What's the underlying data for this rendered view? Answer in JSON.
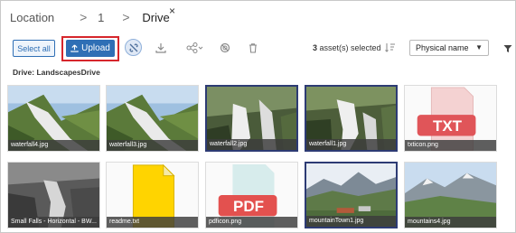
{
  "breadcrumb": {
    "location": "Location",
    "level1": "1",
    "current": "Drive",
    "separator": ">",
    "close_glyph": "×"
  },
  "toolbar": {
    "select_all_label": "Select all",
    "upload_label": "Upload",
    "selection_count": "3",
    "selection_suffix": " asset(s) selected",
    "sort_value": "Physical name",
    "icons": [
      "unlink-icon",
      "download-icon",
      "share-icon",
      "no-entry-icon",
      "trash-icon",
      "sort-icon",
      "filter-icon"
    ]
  },
  "drive": {
    "label": "Drive:",
    "name": "LandscapesDrive"
  },
  "colors": {
    "accent": "#2f6fb5",
    "highlight_border": "#d6262c",
    "selected_border": "#2d3b74",
    "txt_red": "#e05559",
    "pdf_red": "#e3514f",
    "doc_yellow": "#ffd400"
  },
  "assets": [
    {
      "name": "waterfall4.jpg",
      "kind": "waterfall",
      "selected": false
    },
    {
      "name": "waterfall3.jpg",
      "kind": "waterfall",
      "selected": false
    },
    {
      "name": "waterfall2.jpg",
      "kind": "waterfall-dark",
      "selected": true
    },
    {
      "name": "waterfall1.jpg",
      "kind": "waterfall-dark",
      "selected": true
    },
    {
      "name": "txticon.png",
      "kind": "txt",
      "selected": false,
      "badge": "TXT"
    },
    {
      "name": "Small Falls - Horizontal - BW...",
      "kind": "bw",
      "selected": false
    },
    {
      "name": "readme.txt",
      "kind": "doc",
      "selected": false
    },
    {
      "name": "pdficon.png",
      "kind": "pdf",
      "selected": false,
      "badge": "PDF"
    },
    {
      "name": "mountainTown1.jpg",
      "kind": "mountain",
      "selected": true
    },
    {
      "name": "mountains4.jpg",
      "kind": "mountain2",
      "selected": false
    }
  ]
}
